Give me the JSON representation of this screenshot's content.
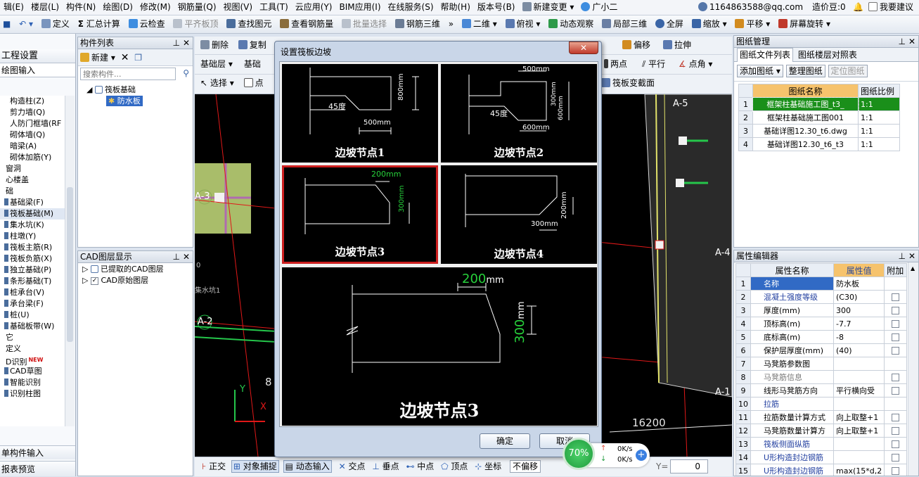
{
  "menu": [
    "辑(E)",
    "楼层(L)",
    "构件(N)",
    "绘图(D)",
    "修改(M)",
    "钢筋量(Q)",
    "视图(V)",
    "工具(T)",
    "云应用(Y)",
    "BIM应用(I)",
    "在线服务(S)",
    "帮助(H)",
    "版本号(B)",
    "新建变更",
    "广小二"
  ],
  "account": {
    "email": "1164863588@qq.com",
    "cost_bean": "造价豆:0",
    "suggest": "我要建议"
  },
  "toolbar": {
    "define": "定义",
    "sum_calc": "汇总计算",
    "cloud_check": "云检查",
    "flat_top": "平齐板顶",
    "find_elem": "查找图元",
    "view_rebar": "查看钢筋量",
    "batch_select": "批量选择",
    "rebar_3d": "钢筋三维",
    "two_d": "二维",
    "top_view": "俯视",
    "dynamic_view": "动态观察",
    "local_3d": "局部三维",
    "fullscreen": "全屏",
    "zoom": "缩放",
    "pan": "平移",
    "screen_rotate": "屏幕旋转"
  },
  "left_nav": {
    "project_settings": "工程设置",
    "drawing_input": "绘图输入",
    "items": [
      "构造柱(Z)",
      "剪力墙(Q)",
      "人防门框墙(RF",
      "砌体墙(Q)",
      "暗梁(A)",
      "砌体加筋(Y)",
      "窗洞",
      "心楼盖",
      "础",
      "基础梁(F)",
      "筏板基础(M)",
      "集水坑(K)",
      "柱墩(Y)",
      "筏板主筋(R)",
      "筏板负筋(X)",
      "独立基础(P)",
      "条形基础(T)",
      "桩承台(V)",
      "承台梁(F)",
      "桩(U)",
      "基础板带(W)",
      "它",
      "定义",
      "D识别",
      "CAD草图",
      "智能识别",
      "识别柱图"
    ],
    "single_input": "单构件输入",
    "report_preview": "报表预览"
  },
  "component_list": {
    "title": "构件列表",
    "new_btn": "新建",
    "search_placeholder": "搜索构件...",
    "tree_parent": "筏板基础",
    "tree_child": "防水板"
  },
  "cad_layer": {
    "title": "CAD图层显示",
    "items": [
      "已提取的CAD图层",
      "CAD原始图层"
    ]
  },
  "draw_toolbar": {
    "delete": "删除",
    "copy": "复制",
    "floor": "基础层",
    "base": "基础",
    "select": "选择",
    "point": "点",
    "offset": "偏移",
    "stretch": "拉伸",
    "two_points": "两点",
    "parallel": "平行",
    "point_angle": "点角",
    "raft_section": "筏板变截面"
  },
  "snap_bar": {
    "ortho": "正交",
    "object_snap": "对象捕捉",
    "dynamic_input": "动态输入",
    "intersection": "交点",
    "perpendicular": "垂点",
    "midpoint": "中点",
    "vertex": "顶点",
    "coordinate": "坐标",
    "no_offset": "不偏移",
    "y_label": "Y=",
    "y_value": "0"
  },
  "canvas": {
    "labels": [
      "A-5",
      "A-4",
      "A-3",
      "A-2",
      "A-1",
      "8",
      "16200",
      "集水坑1",
      "0"
    ]
  },
  "dialog": {
    "title": "设置筏板边坡",
    "cells": [
      {
        "label": "边坡节点1",
        "dims": [
          "45度",
          "500mm",
          "800mm"
        ]
      },
      {
        "label": "边坡节点2",
        "dims": [
          "500mm",
          "45度",
          "600mm",
          "300mm",
          "600mm"
        ]
      },
      {
        "label": "边坡节点3",
        "dims": [
          "200mm",
          "300mm"
        ]
      },
      {
        "label": "边坡节点4",
        "dims": [
          "300mm",
          "200mm"
        ]
      }
    ],
    "preview": {
      "label": "边坡节点3",
      "dim_h": "200",
      "dim_h_unit": "mm",
      "dim_v": "300",
      "dim_v_unit": "mm"
    },
    "ok": "确定",
    "cancel": "取消"
  },
  "speed": {
    "percent": "70%",
    "up": "0K/s",
    "down": "0K/s"
  },
  "drawing_mgmt": {
    "title": "图纸管理",
    "tab1": "图纸文件列表",
    "tab2": "图纸楼层对照表",
    "add_btn": "添加图纸",
    "arrange_btn": "整理图纸",
    "locate_btn": "定位图纸",
    "col_name": "图纸名称",
    "col_scale": "图纸比例",
    "rows": [
      {
        "no": "1",
        "name": "框架柱基础施工图_t3_",
        "scale": "1:1"
      },
      {
        "no": "2",
        "name": "框架柱基础施工图001",
        "scale": "1:1"
      },
      {
        "no": "3",
        "name": "基础详图12.30_t6.dwg",
        "scale": "1:1"
      },
      {
        "no": "4",
        "name": "基础详图12.30_t6_t3",
        "scale": "1:1"
      }
    ]
  },
  "props": {
    "title": "属性编辑器",
    "col_name": "属性名称",
    "col_value": "属性值",
    "col_add": "附加",
    "rows": [
      {
        "no": "1",
        "name": "名称",
        "value": "防水板"
      },
      {
        "no": "2",
        "name": "混凝土强度等级",
        "value": "(C30)"
      },
      {
        "no": "3",
        "name": "厚度(mm)",
        "value": "300"
      },
      {
        "no": "4",
        "name": "顶标高(m)",
        "value": "-7.7"
      },
      {
        "no": "5",
        "name": "底标高(m)",
        "value": "-8"
      },
      {
        "no": "6",
        "name": "保护层厚度(mm)",
        "value": "(40)"
      },
      {
        "no": "7",
        "name": "马凳筋参数图",
        "value": ""
      },
      {
        "no": "8",
        "name": "马凳筋信息",
        "value": ""
      },
      {
        "no": "9",
        "name": "线形马凳筋方向",
        "value": "平行横向受"
      },
      {
        "no": "10",
        "name": "拉筋",
        "value": ""
      },
      {
        "no": "11",
        "name": "拉筋数量计算方式",
        "value": "向上取整+1"
      },
      {
        "no": "12",
        "name": "马凳筋数量计算方",
        "value": "向上取整+1"
      },
      {
        "no": "13",
        "name": "筏板侧面纵筋",
        "value": ""
      },
      {
        "no": "14",
        "name": "U形构造封边钢筋",
        "value": ""
      },
      {
        "no": "15",
        "name": "U形构造封边钢筋",
        "value": "max(15*d,2"
      }
    ]
  },
  "colors": {
    "accent": "#cc1f1f",
    "green": "#1a8f1a",
    "dim_green": "#27d13b",
    "header_orange": "#f6c36d",
    "selected_blue": "#316ac5"
  }
}
